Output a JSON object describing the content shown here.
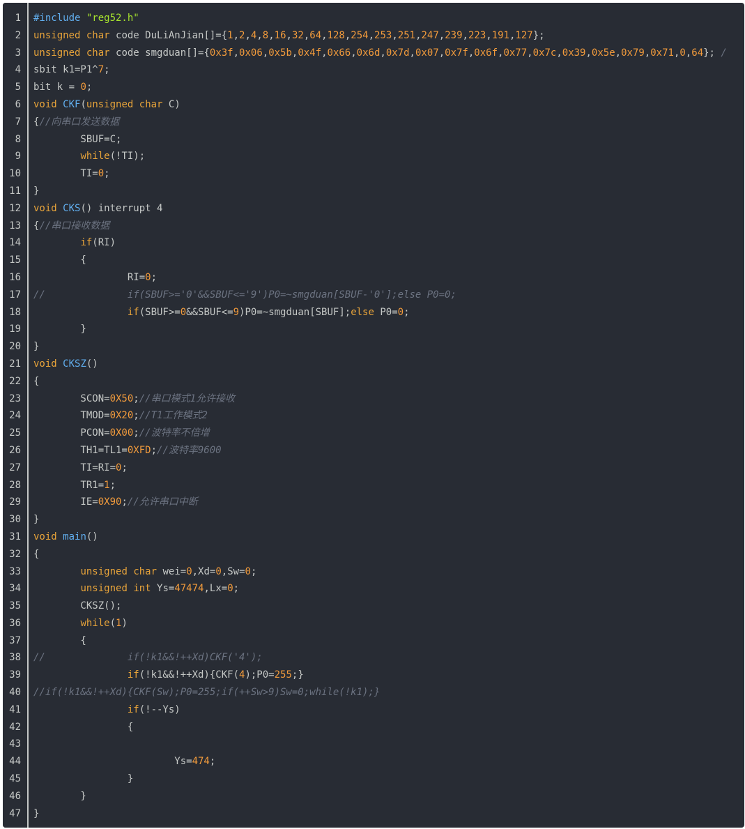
{
  "colors": {
    "background": "#282c34",
    "text": "#c5c8c6",
    "keyword": "#e8a43a",
    "function": "#61aeee",
    "number": "#f29b3c",
    "string": "#a6e22e",
    "comment": "#6b7280"
  },
  "lines": [
    {
      "n": "1",
      "t": [
        [
          "pp",
          "#include "
        ],
        [
          "str",
          "\"reg52.h\""
        ]
      ]
    },
    {
      "n": "2",
      "t": [
        [
          "kw",
          "unsigned"
        ],
        [
          "plain",
          " "
        ],
        [
          "kw",
          "char"
        ],
        [
          "plain",
          " code DuLiAnJian[]={"
        ],
        [
          "num",
          "1"
        ],
        [
          "plain",
          ","
        ],
        [
          "num",
          "2"
        ],
        [
          "plain",
          ","
        ],
        [
          "num",
          "4"
        ],
        [
          "plain",
          ","
        ],
        [
          "num",
          "8"
        ],
        [
          "plain",
          ","
        ],
        [
          "num",
          "16"
        ],
        [
          "plain",
          ","
        ],
        [
          "num",
          "32"
        ],
        [
          "plain",
          ","
        ],
        [
          "num",
          "64"
        ],
        [
          "plain",
          ","
        ],
        [
          "num",
          "128"
        ],
        [
          "plain",
          ","
        ],
        [
          "num",
          "254"
        ],
        [
          "plain",
          ","
        ],
        [
          "num",
          "253"
        ],
        [
          "plain",
          ","
        ],
        [
          "num",
          "251"
        ],
        [
          "plain",
          ","
        ],
        [
          "num",
          "247"
        ],
        [
          "plain",
          ","
        ],
        [
          "num",
          "239"
        ],
        [
          "plain",
          ","
        ],
        [
          "num",
          "223"
        ],
        [
          "plain",
          ","
        ],
        [
          "num",
          "191"
        ],
        [
          "plain",
          ","
        ],
        [
          "num",
          "127"
        ],
        [
          "plain",
          "};"
        ]
      ]
    },
    {
      "n": "3",
      "t": [
        [
          "kw",
          "unsigned"
        ],
        [
          "plain",
          " "
        ],
        [
          "kw",
          "char"
        ],
        [
          "plain",
          " code smgduan[]={"
        ],
        [
          "num",
          "0x3f"
        ],
        [
          "plain",
          ","
        ],
        [
          "num",
          "0x06"
        ],
        [
          "plain",
          ","
        ],
        [
          "num",
          "0x5b"
        ],
        [
          "plain",
          ","
        ],
        [
          "num",
          "0x4f"
        ],
        [
          "plain",
          ","
        ],
        [
          "num",
          "0x66"
        ],
        [
          "plain",
          ","
        ],
        [
          "num",
          "0x6d"
        ],
        [
          "plain",
          ","
        ],
        [
          "num",
          "0x7d"
        ],
        [
          "plain",
          ","
        ],
        [
          "num",
          "0x07"
        ],
        [
          "plain",
          ","
        ],
        [
          "num",
          "0x7f"
        ],
        [
          "plain",
          ","
        ],
        [
          "num",
          "0x6f"
        ],
        [
          "plain",
          ","
        ],
        [
          "num",
          "0x77"
        ],
        [
          "plain",
          ","
        ],
        [
          "num",
          "0x7c"
        ],
        [
          "plain",
          ","
        ],
        [
          "num",
          "0x39"
        ],
        [
          "plain",
          ","
        ],
        [
          "num",
          "0x5e"
        ],
        [
          "plain",
          ","
        ],
        [
          "num",
          "0x79"
        ],
        [
          "plain",
          ","
        ],
        [
          "num",
          "0x71"
        ],
        [
          "plain",
          ","
        ],
        [
          "num",
          "0"
        ],
        [
          "plain",
          ","
        ],
        [
          "num",
          "64"
        ],
        [
          "plain",
          "}; "
        ],
        [
          "cm",
          "/"
        ]
      ]
    },
    {
      "n": "4",
      "t": [
        [
          "plain",
          "sbit k1=P1^"
        ],
        [
          "num",
          "7"
        ],
        [
          "plain",
          ";"
        ]
      ]
    },
    {
      "n": "5",
      "t": [
        [
          "plain",
          "bit k = "
        ],
        [
          "num",
          "0"
        ],
        [
          "plain",
          ";"
        ]
      ]
    },
    {
      "n": "6",
      "t": [
        [
          "kw",
          "void"
        ],
        [
          "plain",
          " "
        ],
        [
          "fn",
          "CKF"
        ],
        [
          "plain",
          "("
        ],
        [
          "kw",
          "unsigned"
        ],
        [
          "plain",
          " "
        ],
        [
          "kw",
          "char"
        ],
        [
          "plain",
          " C)"
        ]
      ]
    },
    {
      "n": "7",
      "t": [
        [
          "plain",
          "{"
        ],
        [
          "cm",
          "//向串口发送数据"
        ]
      ]
    },
    {
      "n": "8",
      "t": [
        [
          "plain",
          "        SBUF=C;"
        ]
      ]
    },
    {
      "n": "9",
      "t": [
        [
          "plain",
          "        "
        ],
        [
          "kw",
          "while"
        ],
        [
          "plain",
          "(!TI);"
        ]
      ]
    },
    {
      "n": "10",
      "t": [
        [
          "plain",
          "        TI="
        ],
        [
          "num",
          "0"
        ],
        [
          "plain",
          ";"
        ]
      ]
    },
    {
      "n": "11",
      "t": [
        [
          "plain",
          "}"
        ]
      ]
    },
    {
      "n": "12",
      "t": [
        [
          "kw",
          "void"
        ],
        [
          "plain",
          " "
        ],
        [
          "fn",
          "CKS"
        ],
        [
          "plain",
          "() interrupt 4"
        ]
      ]
    },
    {
      "n": "13",
      "t": [
        [
          "plain",
          "{"
        ],
        [
          "cm",
          "//串口接收数据"
        ]
      ]
    },
    {
      "n": "14",
      "t": [
        [
          "plain",
          "        "
        ],
        [
          "kw",
          "if"
        ],
        [
          "plain",
          "(RI)"
        ]
      ]
    },
    {
      "n": "15",
      "t": [
        [
          "plain",
          "        {"
        ]
      ]
    },
    {
      "n": "16",
      "t": [
        [
          "plain",
          "                RI="
        ],
        [
          "num",
          "0"
        ],
        [
          "plain",
          ";"
        ]
      ]
    },
    {
      "n": "17",
      "t": [
        [
          "cm",
          "//              if(SBUF>='0'&&SBUF<='9')P0=~smgduan[SBUF-'0'];else P0=0;"
        ]
      ]
    },
    {
      "n": "18",
      "t": [
        [
          "plain",
          "                "
        ],
        [
          "kw",
          "if"
        ],
        [
          "plain",
          "(SBUF>="
        ],
        [
          "num",
          "0"
        ],
        [
          "plain",
          "&&SBUF<="
        ],
        [
          "num",
          "9"
        ],
        [
          "plain",
          ")P0=~smgduan[SBUF];"
        ],
        [
          "kw",
          "else"
        ],
        [
          "plain",
          " P0="
        ],
        [
          "num",
          "0"
        ],
        [
          "plain",
          ";"
        ]
      ]
    },
    {
      "n": "19",
      "t": [
        [
          "plain",
          "        }"
        ]
      ]
    },
    {
      "n": "20",
      "t": [
        [
          "plain",
          "}"
        ]
      ]
    },
    {
      "n": "21",
      "t": [
        [
          "kw",
          "void"
        ],
        [
          "plain",
          " "
        ],
        [
          "fn",
          "CKSZ"
        ],
        [
          "plain",
          "()"
        ]
      ]
    },
    {
      "n": "22",
      "t": [
        [
          "plain",
          "{"
        ]
      ]
    },
    {
      "n": "23",
      "t": [
        [
          "plain",
          "        SCON="
        ],
        [
          "num",
          "0X50"
        ],
        [
          "plain",
          ";"
        ],
        [
          "cm",
          "//串口模式1允许接收"
        ]
      ]
    },
    {
      "n": "24",
      "t": [
        [
          "plain",
          "        TMOD="
        ],
        [
          "num",
          "0X20"
        ],
        [
          "plain",
          ";"
        ],
        [
          "cm",
          "//T1工作模式2"
        ]
      ]
    },
    {
      "n": "25",
      "t": [
        [
          "plain",
          "        PCON="
        ],
        [
          "num",
          "0X00"
        ],
        [
          "plain",
          ";"
        ],
        [
          "cm",
          "//波特率不倍增"
        ]
      ]
    },
    {
      "n": "26",
      "t": [
        [
          "plain",
          "        TH1=TL1="
        ],
        [
          "num",
          "0XFD"
        ],
        [
          "plain",
          ";"
        ],
        [
          "cm",
          "//波特率9600"
        ]
      ]
    },
    {
      "n": "27",
      "t": [
        [
          "plain",
          "        TI=RI="
        ],
        [
          "num",
          "0"
        ],
        [
          "plain",
          ";"
        ]
      ]
    },
    {
      "n": "28",
      "t": [
        [
          "plain",
          "        TR1="
        ],
        [
          "num",
          "1"
        ],
        [
          "plain",
          ";"
        ]
      ]
    },
    {
      "n": "29",
      "t": [
        [
          "plain",
          "        IE="
        ],
        [
          "num",
          "0X90"
        ],
        [
          "plain",
          ";"
        ],
        [
          "cm",
          "//允许串口中断"
        ]
      ]
    },
    {
      "n": "30",
      "t": [
        [
          "plain",
          "}"
        ]
      ]
    },
    {
      "n": "31",
      "t": [
        [
          "kw",
          "void"
        ],
        [
          "plain",
          " "
        ],
        [
          "fn",
          "main"
        ],
        [
          "plain",
          "()"
        ]
      ]
    },
    {
      "n": "32",
      "t": [
        [
          "plain",
          "{"
        ]
      ]
    },
    {
      "n": "33",
      "t": [
        [
          "plain",
          "        "
        ],
        [
          "kw",
          "unsigned"
        ],
        [
          "plain",
          " "
        ],
        [
          "kw",
          "char"
        ],
        [
          "plain",
          " wei="
        ],
        [
          "num",
          "0"
        ],
        [
          "plain",
          ",Xd="
        ],
        [
          "num",
          "0"
        ],
        [
          "plain",
          ",Sw="
        ],
        [
          "num",
          "0"
        ],
        [
          "plain",
          ";"
        ]
      ]
    },
    {
      "n": "34",
      "t": [
        [
          "plain",
          "        "
        ],
        [
          "kw",
          "unsigned"
        ],
        [
          "plain",
          " "
        ],
        [
          "kw",
          "int"
        ],
        [
          "plain",
          " Ys="
        ],
        [
          "num",
          "47474"
        ],
        [
          "plain",
          ",Lx="
        ],
        [
          "num",
          "0"
        ],
        [
          "plain",
          ";"
        ]
      ]
    },
    {
      "n": "35",
      "t": [
        [
          "plain",
          "        CKSZ();"
        ]
      ]
    },
    {
      "n": "36",
      "t": [
        [
          "plain",
          "        "
        ],
        [
          "kw",
          "while"
        ],
        [
          "plain",
          "("
        ],
        [
          "num",
          "1"
        ],
        [
          "plain",
          ")"
        ]
      ]
    },
    {
      "n": "37",
      "t": [
        [
          "plain",
          "        {"
        ]
      ]
    },
    {
      "n": "38",
      "t": [
        [
          "cm",
          "//              if(!k1&&!++Xd)CKF('4');"
        ]
      ]
    },
    {
      "n": "39",
      "t": [
        [
          "plain",
          "                "
        ],
        [
          "kw",
          "if"
        ],
        [
          "plain",
          "(!k1&&!++Xd){CKF("
        ],
        [
          "num",
          "4"
        ],
        [
          "plain",
          ");P0="
        ],
        [
          "num",
          "255"
        ],
        [
          "plain",
          ";}"
        ]
      ]
    },
    {
      "n": "40",
      "t": [
        [
          "cm",
          "//if(!k1&&!++Xd){CKF(Sw);P0=255;if(++Sw>9)Sw=0;while(!k1);}"
        ]
      ]
    },
    {
      "n": "41",
      "t": [
        [
          "plain",
          "                "
        ],
        [
          "kw",
          "if"
        ],
        [
          "plain",
          "(!--Ys)"
        ]
      ]
    },
    {
      "n": "42",
      "t": [
        [
          "plain",
          "                {"
        ]
      ]
    },
    {
      "n": "43",
      "t": [
        [
          "plain",
          ""
        ]
      ]
    },
    {
      "n": "44",
      "t": [
        [
          "plain",
          "                        Ys="
        ],
        [
          "num",
          "474"
        ],
        [
          "plain",
          ";"
        ]
      ]
    },
    {
      "n": "45",
      "t": [
        [
          "plain",
          "                }"
        ]
      ]
    },
    {
      "n": "46",
      "t": [
        [
          "plain",
          "        }"
        ]
      ]
    },
    {
      "n": "47",
      "t": [
        [
          "plain",
          "}"
        ]
      ]
    }
  ]
}
